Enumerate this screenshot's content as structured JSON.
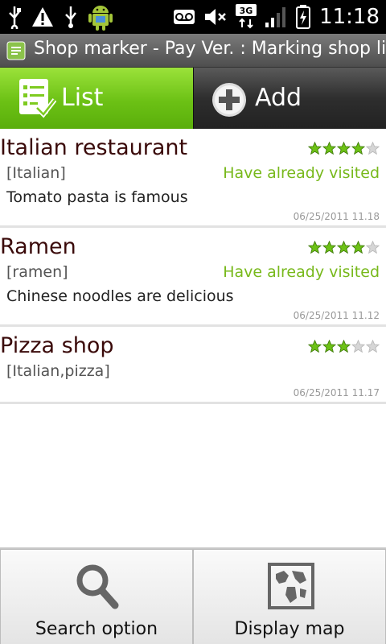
{
  "status_bar": {
    "time": "11:18",
    "network": "3G",
    "left_icons": [
      "usb-icon",
      "warning-icon",
      "usb-debug-icon",
      "android-icon"
    ],
    "right_icons": [
      "voicemail-icon",
      "mute-icon",
      "3g-icon",
      "signal-icon",
      "battery-icon"
    ]
  },
  "title_bar": {
    "title": "Shop marker - Pay Ver. : Marking shop list",
    "icon": "notepad-icon"
  },
  "tabs": [
    {
      "label": "List",
      "icon": "checklist-icon",
      "selected": true
    },
    {
      "label": "Add",
      "icon": "plus-circle-icon",
      "selected": false
    }
  ],
  "shops": [
    {
      "name": "Italian restaurant",
      "category": "[Italian]",
      "comment": "Tomato pasta is famous",
      "status": "Have already visited",
      "date": "06/25/2011 11.18",
      "rating": 4
    },
    {
      "name": "Ramen",
      "category": "[ramen]",
      "comment": "Chinese noodles are delicious",
      "status": "Have already visited",
      "date": "06/25/2011 11.12",
      "rating": 4
    },
    {
      "name": "Pizza shop",
      "category": "[Italian,pizza]",
      "comment": "",
      "status": "",
      "date": "06/25/2011 11.17",
      "rating": 3
    }
  ],
  "bottom_bar": {
    "search_label": "Search option",
    "map_label": "Display map"
  },
  "colors": {
    "accent_green": "#6cc115",
    "visited_text": "#78b91c",
    "star_filled": "#6cc115",
    "star_empty": "#d6d6d6"
  }
}
